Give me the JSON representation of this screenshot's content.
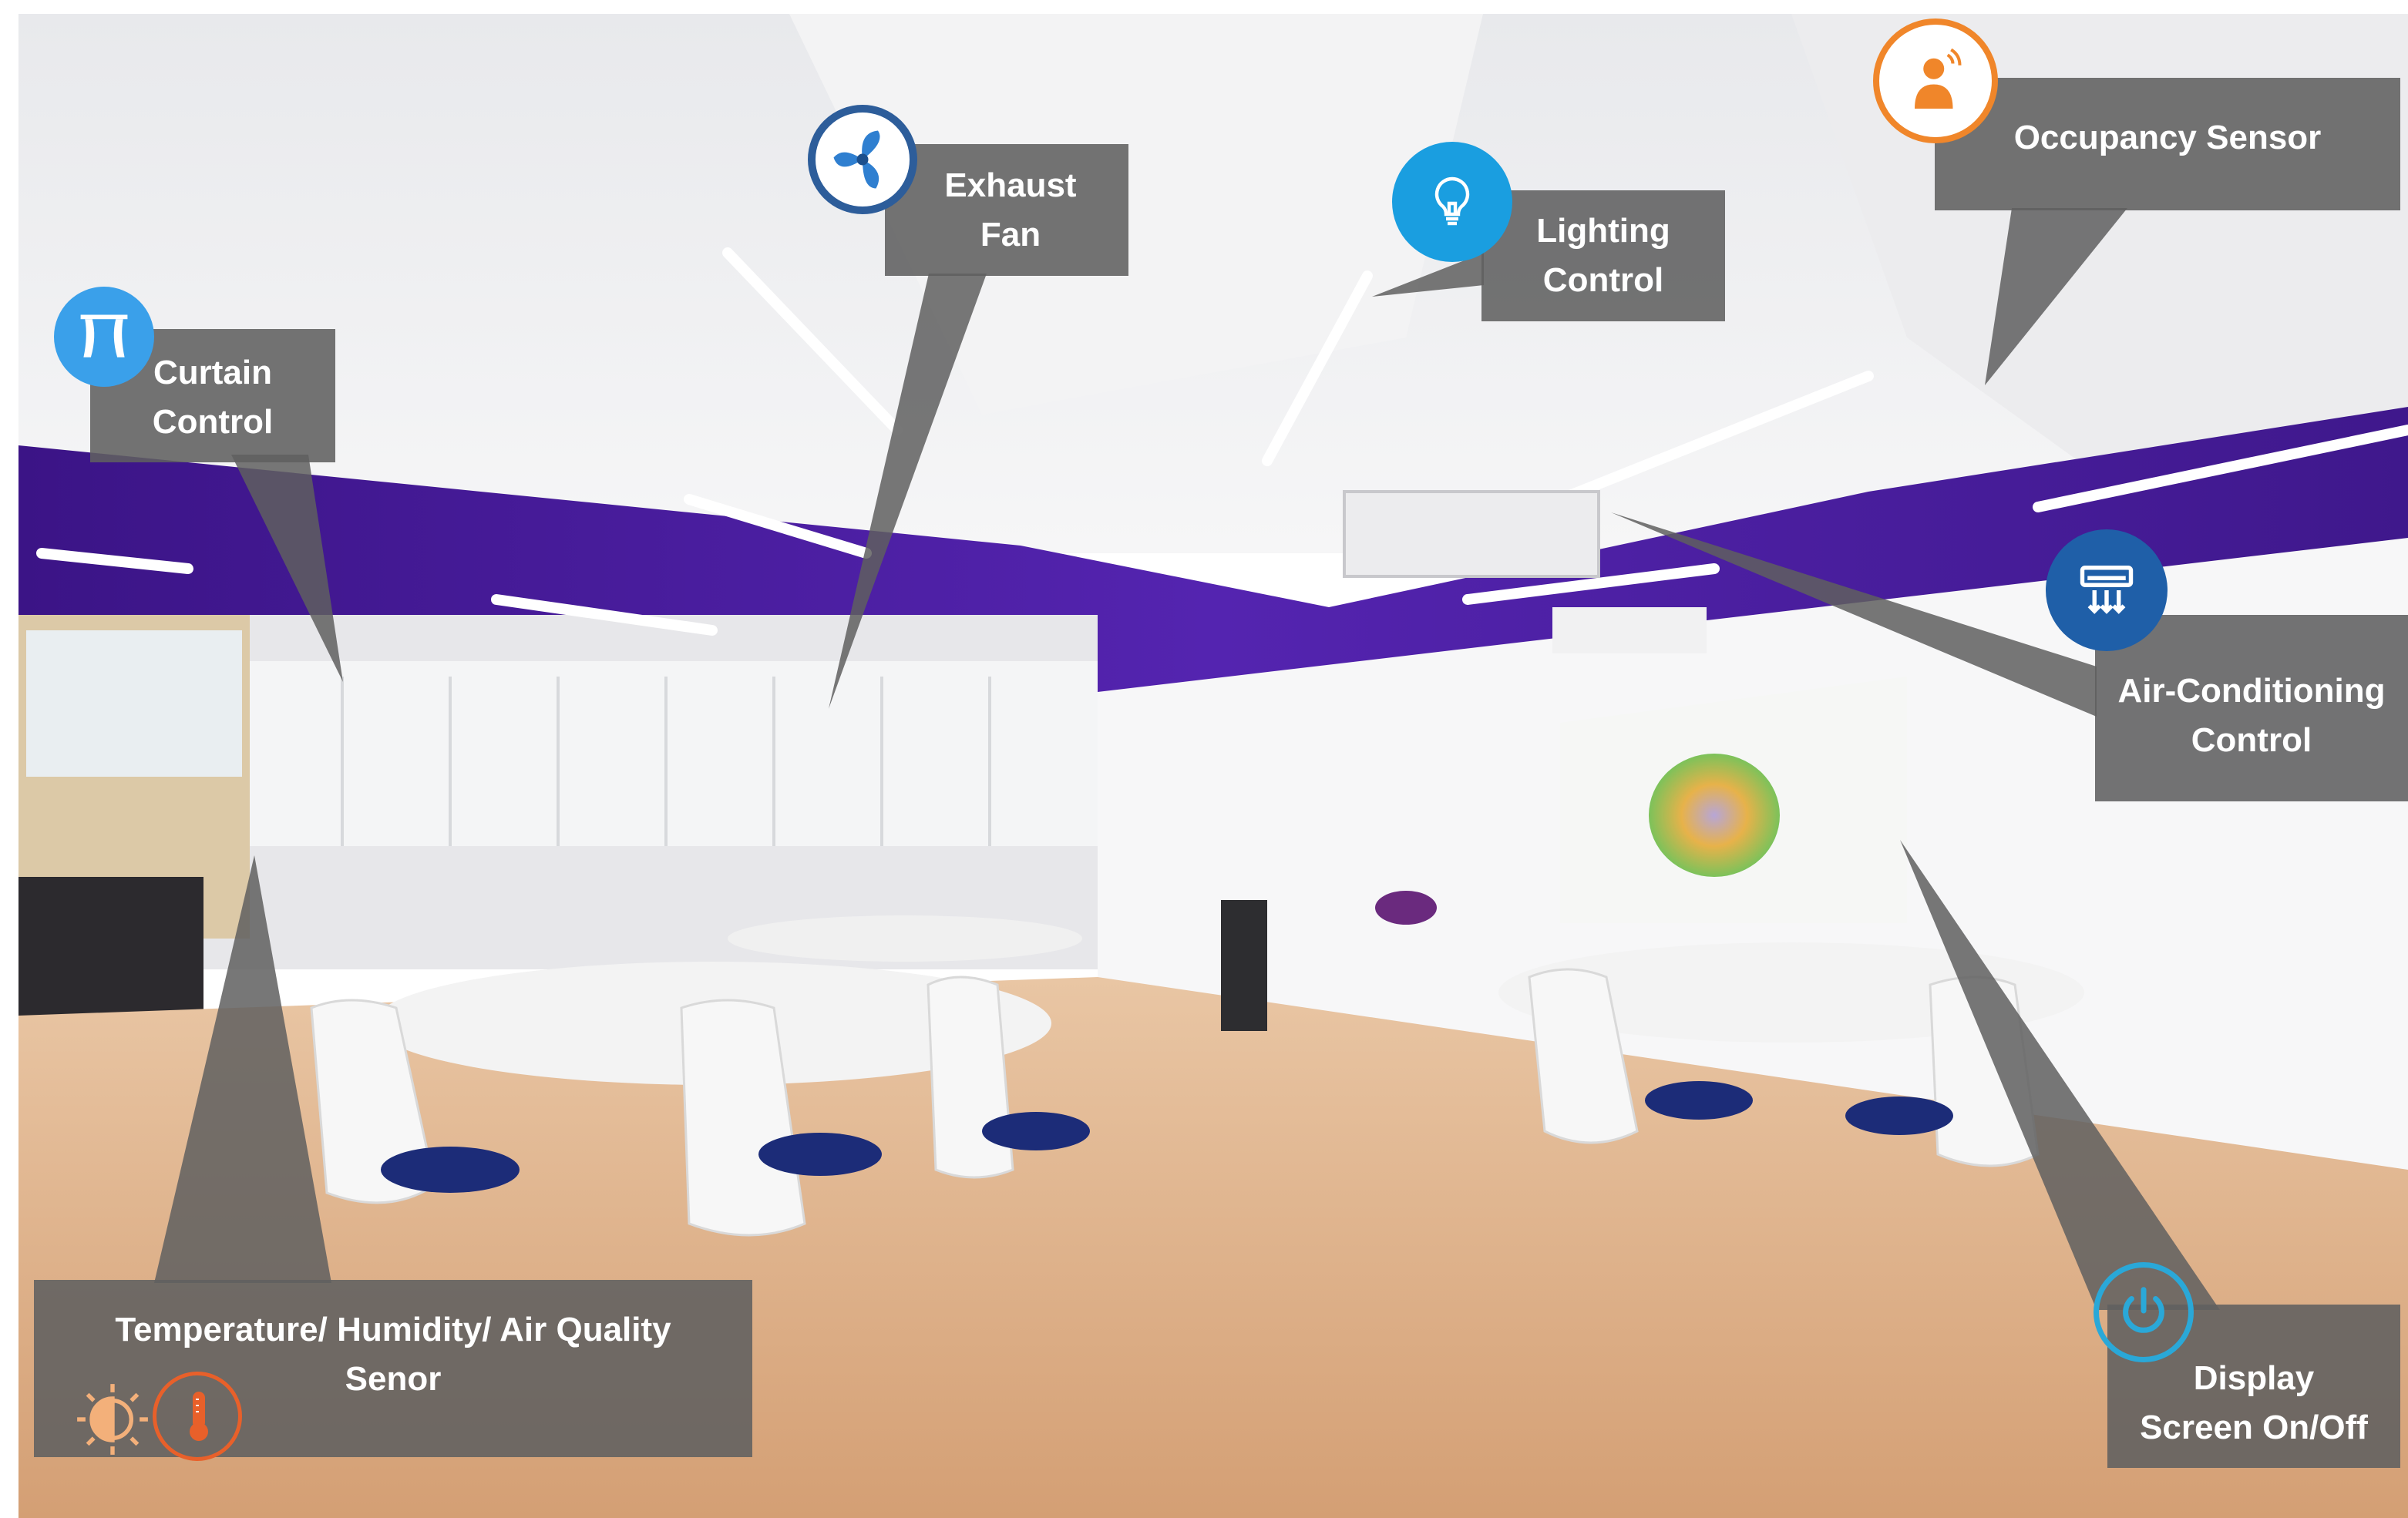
{
  "callouts": {
    "exhaust_fan": {
      "line1": "Exhaust",
      "line2": "Fan",
      "icon": "fan-icon"
    },
    "lighting": {
      "line1": "Lighting",
      "line2": "Control",
      "icon": "lightbulb-icon"
    },
    "occupancy": {
      "line1": "Occupancy Sensor",
      "icon": "person-icon"
    },
    "curtain": {
      "line1": "Curtain",
      "line2": "Control",
      "icon": "curtain-icon"
    },
    "aircon": {
      "line1": "Air-Conditioning",
      "line2": "Control",
      "icon": "air-conditioner-icon"
    },
    "display": {
      "line1": "Display",
      "line2": "Screen On/Off",
      "icon": "power-icon"
    },
    "env_sensor": {
      "line1": "Temperature/ Humidity/ Air Quality",
      "line2": "Senor",
      "icons": [
        "sun-icon",
        "thermometer-icon"
      ]
    }
  },
  "colors": {
    "callout_bg": "#606060",
    "fan": "#2f6fb8",
    "lighting": "#1a9ee0",
    "occupancy": "#f0862a",
    "curtain": "#3aa0ea",
    "aircon": "#1f5fa8",
    "display": "#2aa8d8",
    "thermometer": "#e8602a",
    "ceiling_band": "#4a1d9a",
    "floor": "#d6a77e"
  }
}
